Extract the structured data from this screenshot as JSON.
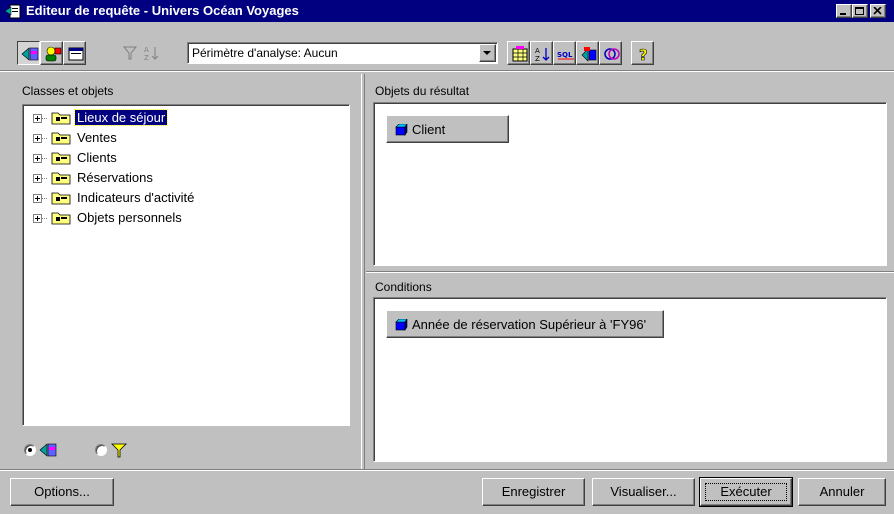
{
  "window": {
    "title": "Editeur de requête - Univers Océan Voyages"
  },
  "toolbar": {
    "scope_value": "Périmètre d'analyse: Aucun"
  },
  "left_panel": {
    "label": "Classes et objets",
    "items": [
      {
        "label": "Lieux de séjour",
        "selected": true
      },
      {
        "label": "Ventes"
      },
      {
        "label": "Clients"
      },
      {
        "label": "Réservations"
      },
      {
        "label": "Indicateurs d'activité"
      },
      {
        "label": "Objets personnels"
      }
    ]
  },
  "result_panel": {
    "label": "Objets du résultat",
    "items": [
      {
        "label": "Client"
      }
    ]
  },
  "conditions_panel": {
    "label": "Conditions",
    "items": [
      {
        "label": "Année de réservation Supérieur à 'FY96'"
      }
    ]
  },
  "buttons": {
    "options": "Options...",
    "save": "Enregistrer",
    "view": "Visualiser...",
    "run": "Exécuter",
    "cancel": "Annuler"
  },
  "colors": {
    "titlebar": "#000080",
    "face": "#c0c0c0",
    "selection": "#000080"
  }
}
